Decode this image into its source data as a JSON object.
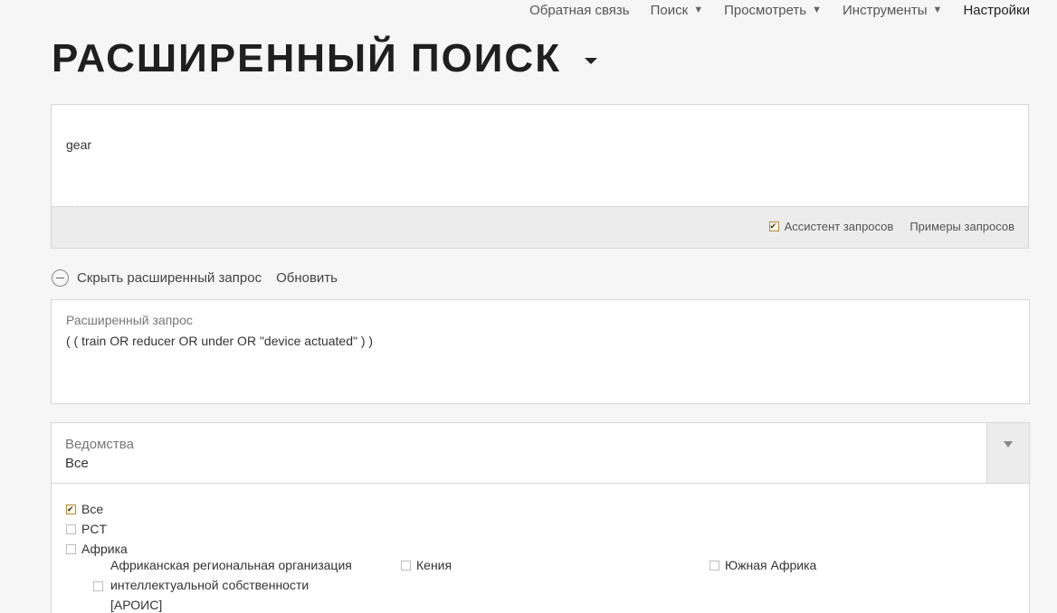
{
  "nav": {
    "feedback": "Обратная связь",
    "search": "Поиск",
    "view": "Просмотреть",
    "tools": "Инструменты",
    "settings": "Настройки"
  },
  "title": "РАСШИРЕННЫЙ ПОИСК",
  "query": {
    "value": "gear",
    "assistant_label": "Ассистент запросов",
    "assistant_checked": true,
    "examples_label": "Примеры запросов"
  },
  "advanced": {
    "hide_label": "Скрыть расширенный запрос",
    "refresh_label": "Обновить",
    "field_label": "Расширенный запрос",
    "field_value": "( ( train OR reducer OR under OR \"device actuated\" ) )"
  },
  "offices": {
    "label": "Ведомства",
    "value": "Все",
    "options": [
      {
        "label": "Все",
        "checked": true
      },
      {
        "label": "PCT",
        "checked": false
      },
      {
        "label": "Африка",
        "checked": false
      }
    ],
    "africa": {
      "aripo_line1": "Африканская региональная организация",
      "aripo_line2": "интеллектуальной собственности",
      "aripo_line3": "[АРОИС]",
      "kenya": "Кения",
      "south_africa": "Южная Африка"
    }
  }
}
